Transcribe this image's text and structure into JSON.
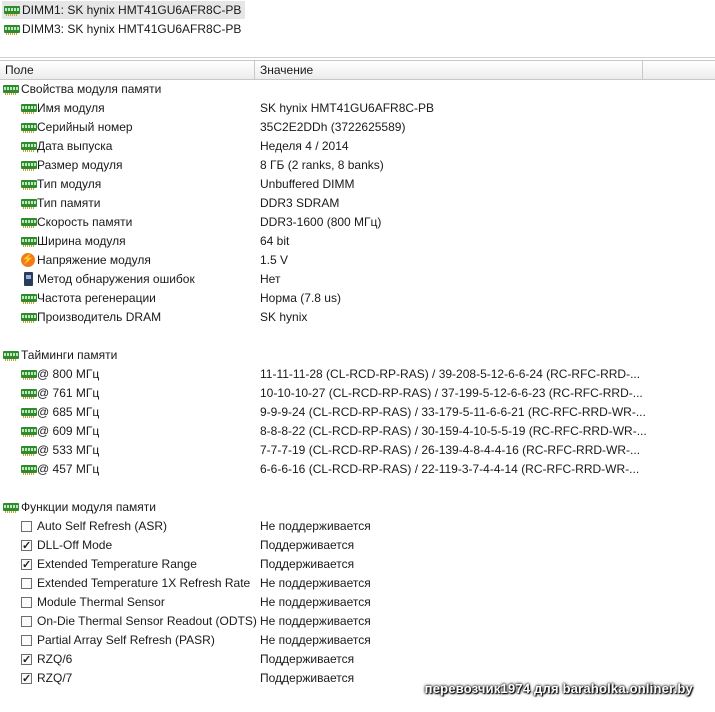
{
  "devices": [
    {
      "label": "DIMM1: SK hynix HMT41GU6AFR8C-PB",
      "icon": "ram-module-icon",
      "selected": true
    },
    {
      "label": "DIMM3: SK hynix HMT41GU6AFR8C-PB",
      "icon": "ram-module-icon",
      "selected": false
    }
  ],
  "columns": {
    "field": "Поле",
    "value": "Значение"
  },
  "groups": {
    "properties": {
      "title": "Свойства модуля памяти",
      "rows": [
        {
          "field": "Имя модуля",
          "value": "SK hynix HMT41GU6AFR8C-PB",
          "icon": "ram-module-icon"
        },
        {
          "field": "Серийный номер",
          "value": "35C2E2DDh (3722625589)",
          "icon": "ram-module-icon"
        },
        {
          "field": "Дата выпуска",
          "value": "Неделя 4 / 2014",
          "icon": "ram-module-icon"
        },
        {
          "field": "Размер модуля",
          "value": "8 ГБ (2 ranks, 8 banks)",
          "icon": "ram-module-icon"
        },
        {
          "field": "Тип модуля",
          "value": "Unbuffered DIMM",
          "icon": "ram-module-icon"
        },
        {
          "field": "Тип памяти",
          "value": "DDR3 SDRAM",
          "icon": "ram-module-icon"
        },
        {
          "field": "Скорость памяти",
          "value": "DDR3-1600 (800 МГц)",
          "icon": "ram-module-icon"
        },
        {
          "field": "Ширина модуля",
          "value": "64 bit",
          "icon": "ram-module-icon"
        },
        {
          "field": "Напряжение модуля",
          "value": "1.5 V",
          "icon": "voltage-icon"
        },
        {
          "field": "Метод обнаружения ошибок",
          "value": "Нет",
          "icon": "chip-icon"
        },
        {
          "field": "Частота регенерации",
          "value": "Норма (7.8 us)",
          "icon": "ram-module-icon"
        },
        {
          "field": "Производитель DRAM",
          "value": "SK hynix",
          "icon": "ram-module-icon"
        }
      ]
    },
    "timings": {
      "title": "Тайминги памяти",
      "rows": [
        {
          "field": "@ 800 МГц",
          "value": "11-11-11-28  (CL-RCD-RP-RAS) / 39-208-5-12-6-6-24  (RC-RFC-RRD-..."
        },
        {
          "field": "@ 761 МГц",
          "value": "10-10-10-27  (CL-RCD-RP-RAS) / 37-199-5-12-6-6-23  (RC-RFC-RRD-..."
        },
        {
          "field": "@ 685 МГц",
          "value": "9-9-9-24  (CL-RCD-RP-RAS) / 33-179-5-11-6-6-21  (RC-RFC-RRD-WR-..."
        },
        {
          "field": "@ 609 МГц",
          "value": "8-8-8-22  (CL-RCD-RP-RAS) / 30-159-4-10-5-5-19  (RC-RFC-RRD-WR-..."
        },
        {
          "field": "@ 533 МГц",
          "value": "7-7-7-19  (CL-RCD-RP-RAS) / 26-139-4-8-4-4-16  (RC-RFC-RRD-WR-..."
        },
        {
          "field": "@ 457 МГц",
          "value": "6-6-6-16  (CL-RCD-RP-RAS) / 22-119-3-7-4-4-14  (RC-RFC-RRD-WR-..."
        }
      ]
    },
    "features": {
      "title": "Функции модуля памяти",
      "rows": [
        {
          "field": "Auto Self Refresh (ASR)",
          "value": "Не поддерживается",
          "checked": false
        },
        {
          "field": "DLL-Off Mode",
          "value": "Поддерживается",
          "checked": true
        },
        {
          "field": "Extended Temperature Range",
          "value": "Поддерживается",
          "checked": true
        },
        {
          "field": "Extended Temperature 1X Refresh Rate",
          "value": "Не поддерживается",
          "checked": false
        },
        {
          "field": "Module Thermal Sensor",
          "value": "Не поддерживается",
          "checked": false
        },
        {
          "field": "On-Die Thermal Sensor Readout (ODTS)",
          "value": "Не поддерживается",
          "checked": false
        },
        {
          "field": "Partial Array Self Refresh (PASR)",
          "value": "Не поддерживается",
          "checked": false
        },
        {
          "field": "RZQ/6",
          "value": "Поддерживается",
          "checked": true
        },
        {
          "field": "RZQ/7",
          "value": "Поддерживается",
          "checked": true
        }
      ]
    }
  },
  "watermark": "перевозчик1974 для baraholka.onliner.by"
}
